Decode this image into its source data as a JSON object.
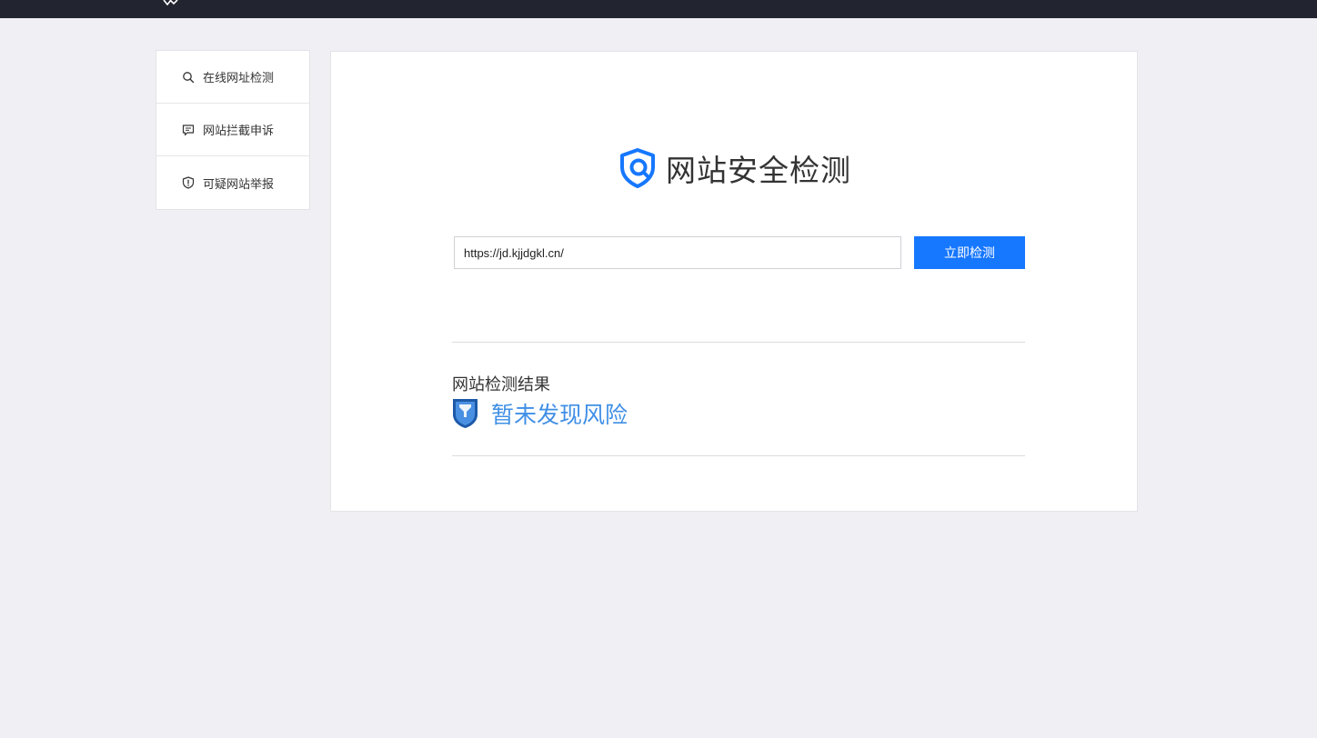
{
  "sidebar": {
    "items": [
      {
        "label": "在线网址检测",
        "icon": "search-icon"
      },
      {
        "label": "网站拦截申诉",
        "icon": "message-icon"
      },
      {
        "label": "可疑网站举报",
        "icon": "shield-alert-icon"
      }
    ]
  },
  "main": {
    "title": "网站安全检测",
    "search": {
      "value": "https://jd.kjjdgkl.cn/",
      "button_label": "立即检测"
    },
    "result": {
      "heading": "网站检测结果",
      "status": "暂未发现风险"
    }
  },
  "colors": {
    "topbar": "#22242f",
    "background": "#efeff4",
    "accent": "#1677ff",
    "status_text": "#3f8fe6",
    "shield_dark": "#1c5aa8",
    "shield_light": "#4a90e2"
  }
}
